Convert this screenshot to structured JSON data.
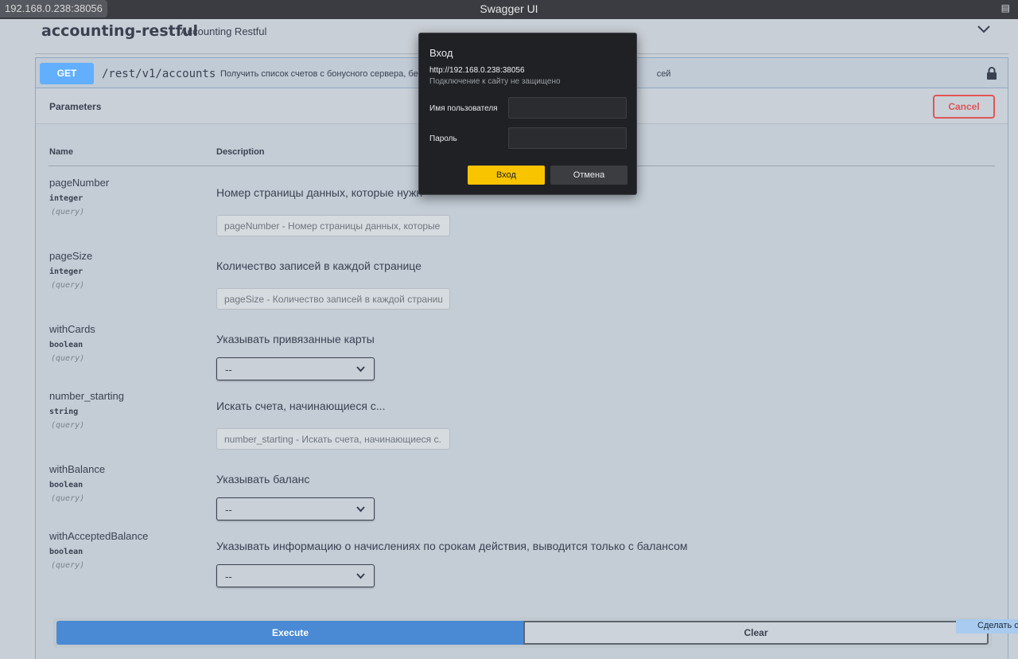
{
  "window": {
    "url": "192.168.0.238:38056",
    "title": "Swagger UI"
  },
  "header": {
    "title": "accounting-restful",
    "subtitle": "Accounting Restful"
  },
  "operation": {
    "method": "GET",
    "path": "/rest/v1/accounts",
    "description_left": "Получить список счетов с бонусного сервера, бе",
    "description_right": "сей",
    "parameters_title": "Parameters",
    "cancel_label": "Cancel",
    "col_name": "Name",
    "col_description": "Description",
    "params": [
      {
        "name": "pageNumber",
        "type": "integer",
        "in": "(query)",
        "description": "Номер страницы данных, которые нужн",
        "placeholder": "pageNumber - Номер страницы данных, которые ну"
      },
      {
        "name": "pageSize",
        "type": "integer",
        "in": "(query)",
        "description": "Количество записей в каждой странице",
        "placeholder": "pageSize - Количество записей в каждой странице"
      },
      {
        "name": "withCards",
        "type": "boolean",
        "in": "(query)",
        "description": "Указывать привязанные карты",
        "selected": "--"
      },
      {
        "name": "number_starting",
        "type": "string",
        "in": "(query)",
        "description": "Искать счета, начинающиеся с...",
        "placeholder": "number_starting - Искать счета, начинающиеся с..."
      },
      {
        "name": "withBalance",
        "type": "boolean",
        "in": "(query)",
        "description": "Указывать баланс",
        "selected": "--"
      },
      {
        "name": "withAcceptedBalance",
        "type": "boolean",
        "in": "(query)",
        "description": "Указывать информацию о начислениях по срокам действия, выводится только с балансом",
        "selected": "--"
      }
    ],
    "execute_label": "Execute",
    "clear_label": "Clear"
  },
  "snip_tooltip": "Сделать ск",
  "auth_dialog": {
    "title": "Вход",
    "host": "http://192.168.0.238:38056",
    "warning": "Подключение к сайту не защищено",
    "username_label": "Имя пользователя",
    "password_label": "Пароль",
    "ok_label": "Вход",
    "cancel_label": "Отмена"
  },
  "colors": {
    "get_method": "#61affe",
    "execute": "#4a8ad4",
    "cancel": "#e05555",
    "dialog_ok": "#f8c400",
    "dialog_bg": "#202124"
  },
  "icons": [
    "chevron-down-icon",
    "lock-icon",
    "extension-icon"
  ]
}
